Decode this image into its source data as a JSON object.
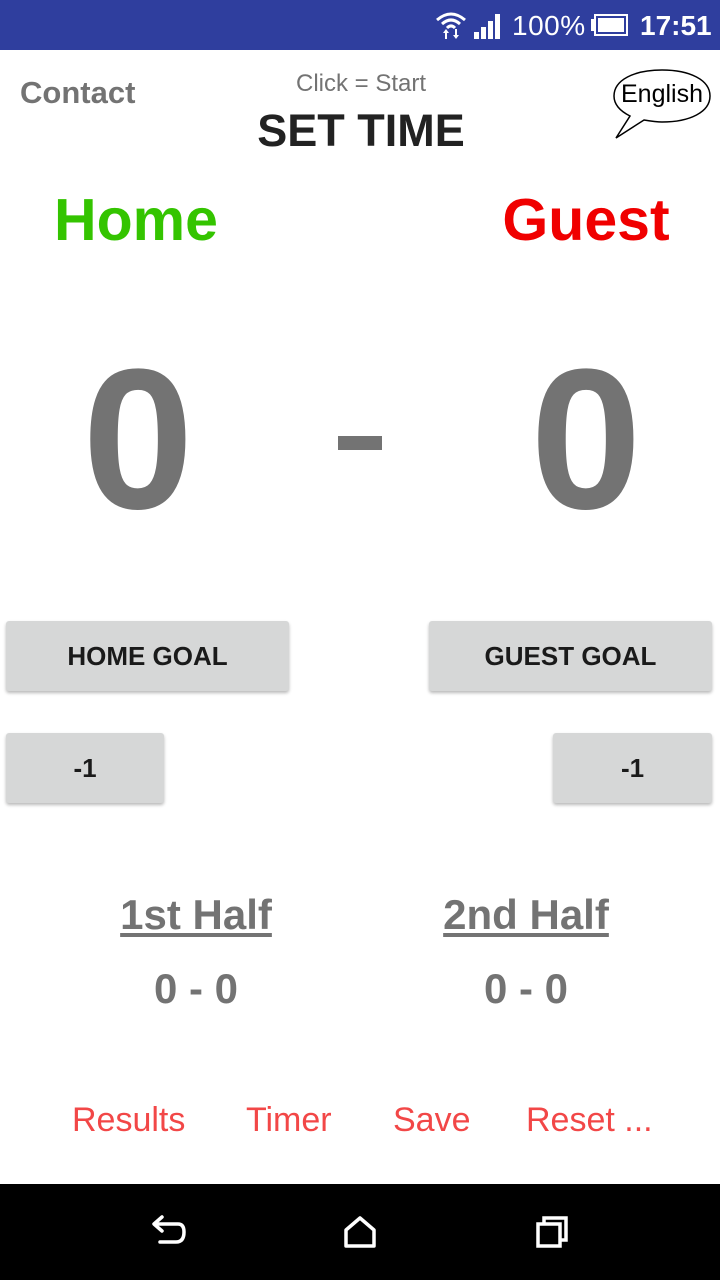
{
  "status_bar": {
    "battery_percent": "100%",
    "time": "17:51",
    "icons": [
      "wifi-icon",
      "cell-signal-icon",
      "battery-icon"
    ]
  },
  "top": {
    "contact_label": "Contact",
    "timer_hint": "Click = Start",
    "timer_label": "SET TIME",
    "language_label": "English"
  },
  "teams": {
    "home_name": "Home",
    "guest_name": "Guest",
    "home_color": "#34c400",
    "guest_color": "#f00000"
  },
  "score": {
    "home": "0",
    "guest": "0"
  },
  "buttons": {
    "home_goal": "HOME GOAL",
    "guest_goal": "GUEST GOAL",
    "home_minus": "-1",
    "guest_minus": "-1"
  },
  "halves": {
    "first_title": "1st Half",
    "first_score": "0 - 0",
    "second_title": "2nd Half",
    "second_score": "0 - 0"
  },
  "menu": {
    "results": "Results",
    "timer": "Timer",
    "save": "Save",
    "reset": "Reset ...",
    "link_color": "#f24747"
  },
  "nav_bar": {
    "icons": [
      "back-icon",
      "home-icon",
      "recents-icon"
    ]
  }
}
